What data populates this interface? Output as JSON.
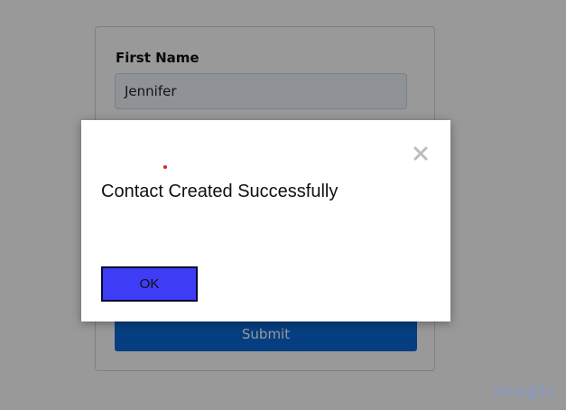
{
  "form": {
    "first_name_label": "First Name",
    "first_name_value": "Jennifer",
    "submit_label": "Submit"
  },
  "dialog": {
    "message": "Contact Created Successfully",
    "ok_label": "OK",
    "close_icon": "close-icon"
  },
  "watermark": {
    "text": "inogic"
  },
  "colors": {
    "ok_button": "#3f3cf5",
    "submit_button": "#0a6ad8",
    "watermark": "#8d98b6",
    "indicator_dot": "#e02020"
  }
}
